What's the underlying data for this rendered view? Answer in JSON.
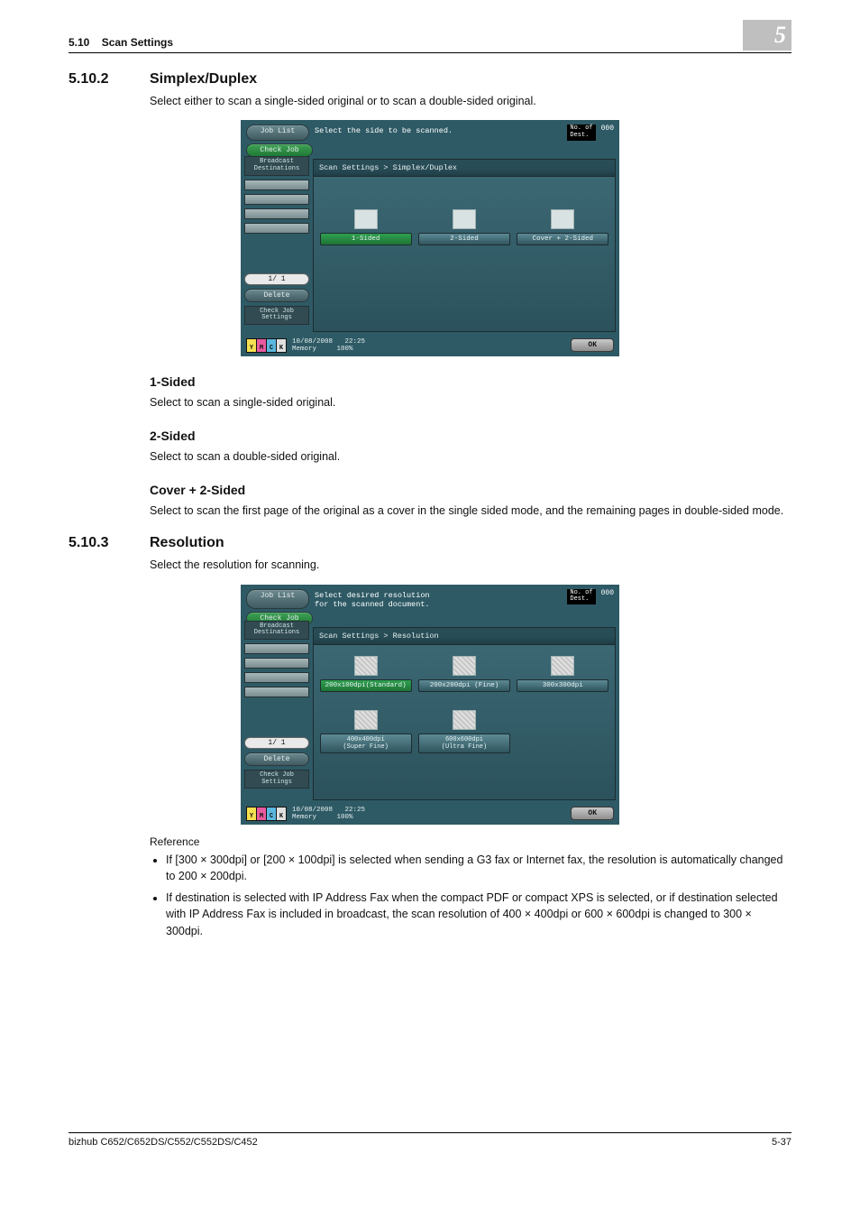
{
  "runhead": {
    "section_num": "5.10",
    "section_title": "Scan Settings",
    "chapter": "5"
  },
  "sec1": {
    "num": "5.10.2",
    "title": "Simplex/Duplex",
    "intro": "Select either to scan a single-sided original or to scan a double-sided original."
  },
  "screenshot1": {
    "job_list": "Job List",
    "check_job": "Check Job",
    "instruction": "Select the side to be scanned.",
    "counter_label": "No. of\nDest.",
    "counter_value": "000",
    "broadcast": "Broadcast\nDestinations",
    "page_indicator": "1/  1",
    "delete": "Delete",
    "check_settings": "Check Job\nSettings",
    "breadcrumb": "Scan Settings > Simplex/Duplex",
    "options": [
      {
        "label": "1-Sided",
        "selected": true
      },
      {
        "label": "2-Sided",
        "selected": false
      },
      {
        "label": "Cover + 2-Sided",
        "selected": false
      }
    ],
    "toner": [
      "Y",
      "M",
      "C",
      "K"
    ],
    "status_date": "10/08/2008",
    "status_time": "22:25",
    "status_mem_label": "Memory",
    "status_mem_value": "100%",
    "ok": "OK"
  },
  "subs": {
    "h1": "1-Sided",
    "p1": "Select to scan a single-sided original.",
    "h2": "2-Sided",
    "p2": "Select to scan a double-sided original.",
    "h3": "Cover + 2-Sided",
    "p3": "Select to scan the first page of the original as a cover in the single sided mode, and the remaining pages in double-sided mode."
  },
  "sec2": {
    "num": "5.10.3",
    "title": "Resolution",
    "intro": "Select the resolution for scanning."
  },
  "screenshot2": {
    "job_list": "Job List",
    "check_job": "Check Job",
    "instruction": "Select desired resolution\nfor the scanned document.",
    "counter_label": "No. of\nDest.",
    "counter_value": "000",
    "broadcast": "Broadcast\nDestinations",
    "page_indicator": "1/  1",
    "delete": "Delete",
    "check_settings": "Check Job\nSettings",
    "breadcrumb": "Scan Settings > Resolution",
    "options_row1": [
      {
        "label": "200x100dpi(Standard)",
        "selected": true
      },
      {
        "label": "200x200dpi (Fine)",
        "selected": false
      },
      {
        "label": "300x300dpi",
        "selected": false
      }
    ],
    "options_row2": [
      {
        "label": "400x400dpi\n(Super Fine)",
        "selected": false
      },
      {
        "label": "600x600dpi\n(Ultra Fine)",
        "selected": false
      }
    ],
    "toner": [
      "Y",
      "M",
      "C",
      "K"
    ],
    "status_date": "10/08/2008",
    "status_time": "22:25",
    "status_mem_label": "Memory",
    "status_mem_value": "100%",
    "ok": "OK"
  },
  "reference": {
    "title": "Reference",
    "items": [
      "If [300 × 300dpi] or [200 × 100dpi] is selected when sending a G3 fax or Internet fax, the resolution is automatically changed to 200 × 200dpi.",
      "If destination is selected with IP Address Fax when the compact PDF or compact XPS is selected, or if destination selected with IP Address Fax is included in broadcast, the scan resolution of 400 × 400dpi or 600 × 600dpi is changed to 300 × 300dpi."
    ]
  },
  "footer": {
    "left": "bizhub C652/C652DS/C552/C552DS/C452",
    "right": "5-37"
  }
}
